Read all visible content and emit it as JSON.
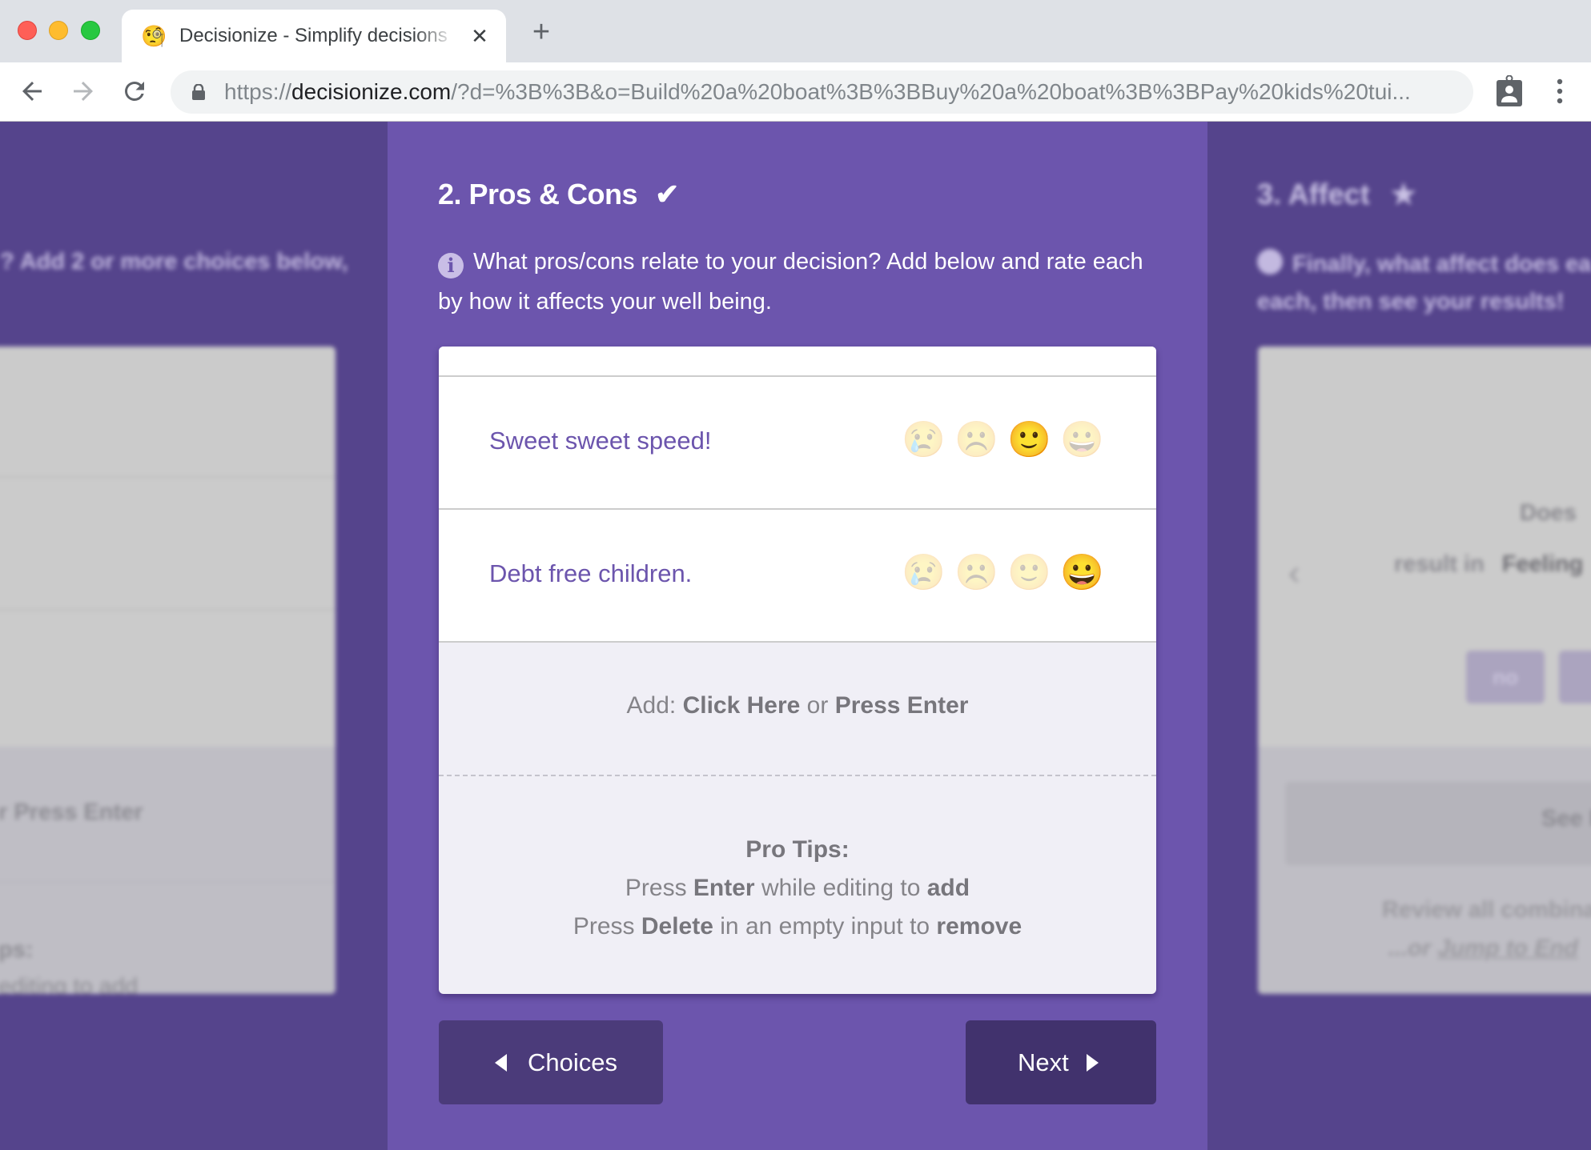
{
  "browser": {
    "tab": {
      "favicon": "🧐",
      "title": "Decisionize - Simplify decisions",
      "close_icon": "✕"
    },
    "new_tab_icon": "+",
    "url_scheme": "https://",
    "url_host": "decisionize.com",
    "url_rest": "/?d=%3B%3B&o=Build%20a%20boat%3B%3BBuy%20a%20boat%3B%3BPay%20kids%20tui..."
  },
  "left_panel": {
    "info_fragment": "? Add 2 or more choices below,",
    "add_fragment": "r Press Enter",
    "tips_fragment_1": "ps:",
    "tips_fragment_2": "editing to add"
  },
  "center_panel": {
    "title": "2. Pros & Cons",
    "title_icon": "✔",
    "info_icon": "i",
    "info_text": "What pros/cons relate to your decision? Add below and rate each by how it affects your well being.",
    "items": [
      {
        "text": "Sweet sweet speed!",
        "rating_options": [
          "😢",
          "☹️",
          "🙂",
          "😀"
        ],
        "selected_index": 2
      },
      {
        "text": "Debt free children.",
        "rating_options": [
          "😢",
          "☹️",
          "🙂",
          "😀"
        ],
        "selected_index": 3
      }
    ],
    "add": {
      "prefix": "Add: ",
      "click_here": "Click Here",
      "or": " or ",
      "press_enter": "Press Enter"
    },
    "tips": {
      "heading": "Pro Tips:",
      "line1": {
        "a": "Press ",
        "b": "Enter",
        "c": " while editing to ",
        "d": "add"
      },
      "line2": {
        "a": "Press ",
        "b": "Delete",
        "c": " in an empty input to ",
        "d": "remove"
      }
    },
    "back_button": "Choices",
    "next_button": "Next"
  },
  "right_panel": {
    "title": "3. Affect",
    "title_icon": "★",
    "info_line1": "Finally, what affect does ea",
    "info_line2": "each, then see your results!",
    "question_line1": "Does",
    "question_line2a": "result in",
    "question_line2b": "Feeling",
    "answer_button": "no",
    "see_results": "See R",
    "review_text": "Review all combina",
    "jump_prefix": "...or ",
    "jump_link": "Jump to End"
  },
  "colors": {
    "accent": "#6c55ad",
    "side_background": "#55448c",
    "button_dark": "#41326d"
  }
}
